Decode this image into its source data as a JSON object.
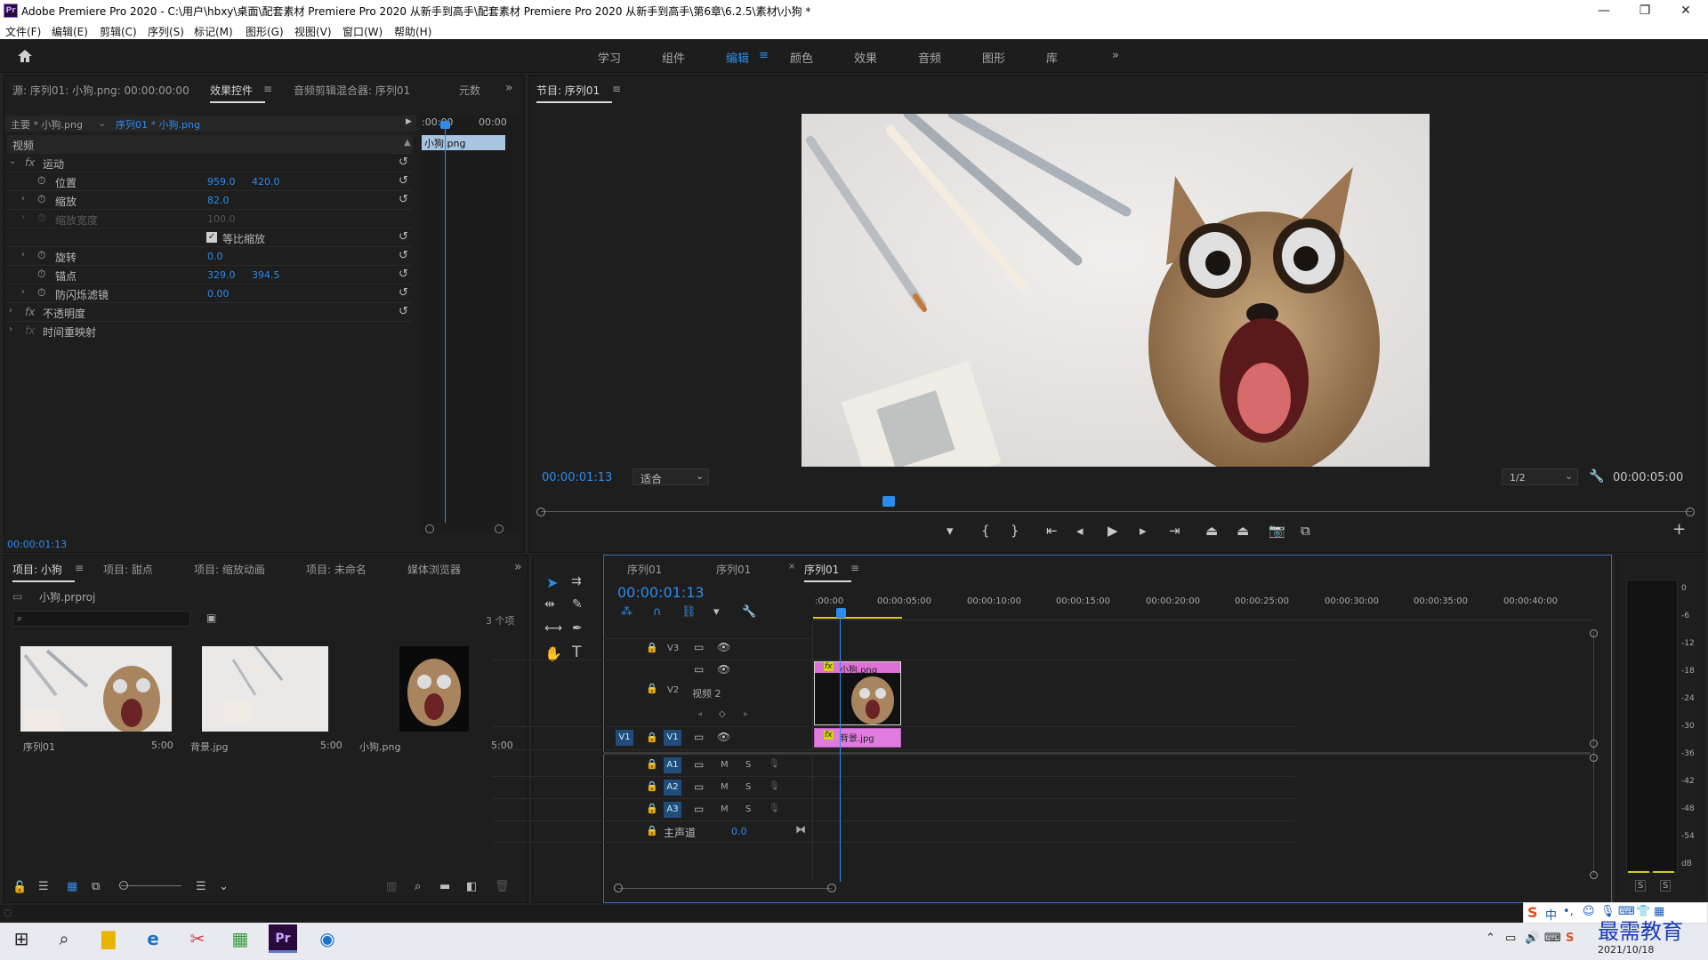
{
  "window": {
    "title": "Adobe Premiere Pro 2020 - C:\\用户\\hbxy\\桌面\\配套素材 Premiere Pro 2020 从新手到高手\\配套素材 Premiere Pro 2020 从新手到高手\\第6章\\6.2.5\\素材\\小狗 *",
    "app_icon": "Pr",
    "minimize": "—",
    "maximize": "❐",
    "close": "✕"
  },
  "menu": [
    "文件(F)",
    "编辑(E)",
    "剪辑(C)",
    "序列(S)",
    "标记(M)",
    "图形(G)",
    "视图(V)",
    "窗口(W)",
    "帮助(H)"
  ],
  "workspaces": {
    "items": [
      "学习",
      "组件",
      "编辑",
      "颜色",
      "效果",
      "音频",
      "图形",
      "库"
    ],
    "active": "编辑",
    "more": "»"
  },
  "effect_panel": {
    "tabs": [
      "源: 序列01: 小狗.png: 00:00:00:00",
      "效果控件",
      "音频剪辑混合器: 序列01",
      "元数"
    ],
    "active_tab": "效果控件",
    "master_label": "主要 * 小狗.png",
    "seq_label": "序列01 * 小狗.png",
    "time_start": ":00:00",
    "time_end": "00:00",
    "clip_name": "小狗.png",
    "section_video": "视频",
    "motion": "运动",
    "props": [
      {
        "label": "位置",
        "v1": "959.0",
        "v2": "420.0"
      },
      {
        "label": "缩放",
        "v1": "82.0",
        "v2": ""
      },
      {
        "label": "缩放宽度",
        "v1": "100.0",
        "v2": ""
      },
      {
        "label": "等比缩放",
        "v1": "",
        "v2": ""
      },
      {
        "label": "旋转",
        "v1": "0.0",
        "v2": ""
      },
      {
        "label": "锚点",
        "v1": "329.0",
        "v2": "394.5"
      },
      {
        "label": "防闪烁滤镜",
        "v1": "0.00",
        "v2": ""
      }
    ],
    "opacity": "不透明度",
    "time_remap": "时间重映射",
    "timecode": "00:00:01:13"
  },
  "program": {
    "title": "节目: 序列01",
    "timecode": "00:00:01:13",
    "fit": "适合",
    "quality": "1/2",
    "duration": "00:00:05:00"
  },
  "project": {
    "tabs": [
      "项目: 小狗",
      "项目: 甜点",
      "项目: 缩放动画",
      "项目: 未命名",
      "媒体浏览器"
    ],
    "file": "小狗.prproj",
    "count": "3 个项",
    "items": [
      {
        "name": "序列01",
        "dur": "5:00"
      },
      {
        "name": "背景.jpg",
        "dur": "5:00"
      },
      {
        "name": "小狗.png",
        "dur": "5:00"
      }
    ]
  },
  "timeline": {
    "tabs": [
      "序列01",
      "序列01",
      "序列01"
    ],
    "active_tab": "序列01",
    "timecode": "00:00:01:13",
    "ruler": [
      ":00:00",
      "00:00:05:00",
      "00:00:10:00",
      "00:00:15:00",
      "00:00:20:00",
      "00:00:25:00",
      "00:00:30:00",
      "00:00:35:00",
      "00:00:40:00"
    ],
    "tracks": {
      "v3": "V3",
      "v2": "V2",
      "v2_name": "视频 2",
      "v1": "V1",
      "src_v1": "V1",
      "a1": "A1",
      "a2": "A2",
      "a3": "A3",
      "m": "M",
      "s": "S"
    },
    "master": "主声道",
    "master_val": "0.0",
    "clip_v2": "小狗.png",
    "clip_v1": "背景.jpg",
    "fx": "fx"
  },
  "meter": {
    "ticks": [
      "0",
      "-6",
      "-12",
      "-18",
      "-24",
      "-30",
      "-36",
      "-42",
      "-48",
      "-54",
      "dB"
    ],
    "s1": "S",
    "s2": "S"
  },
  "taskbar": {
    "date": "2021/10/18",
    "watermark": "最需教育",
    "ime": "中"
  }
}
